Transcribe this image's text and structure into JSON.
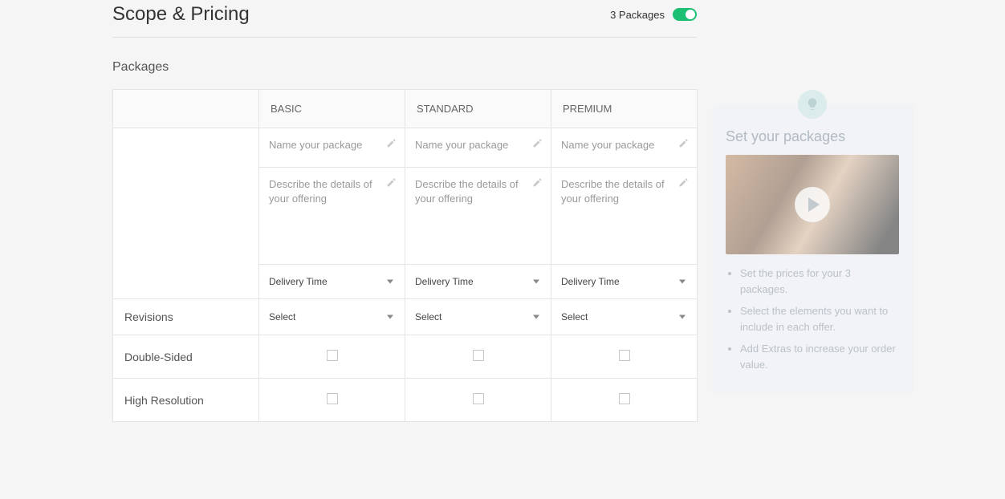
{
  "header": {
    "title": "Scope & Pricing",
    "toggle_label": "3 Packages"
  },
  "section": {
    "packages_label": "Packages"
  },
  "packages": {
    "columns": [
      "BASIC",
      "STANDARD",
      "PREMIUM"
    ],
    "name_placeholder": "Name your package",
    "desc_placeholder": "Describe the details of your offering",
    "delivery_label": "Delivery Time",
    "revisions_row": "Revisions",
    "revisions_select": "Select",
    "feature_rows": [
      "Double-Sided",
      "High Resolution"
    ]
  },
  "tip": {
    "title": "Set your packages",
    "bullets": [
      "Set the prices for your 3 packages.",
      "Select the elements you want to include in each offer.",
      "Add Extras to increase your order value."
    ]
  }
}
